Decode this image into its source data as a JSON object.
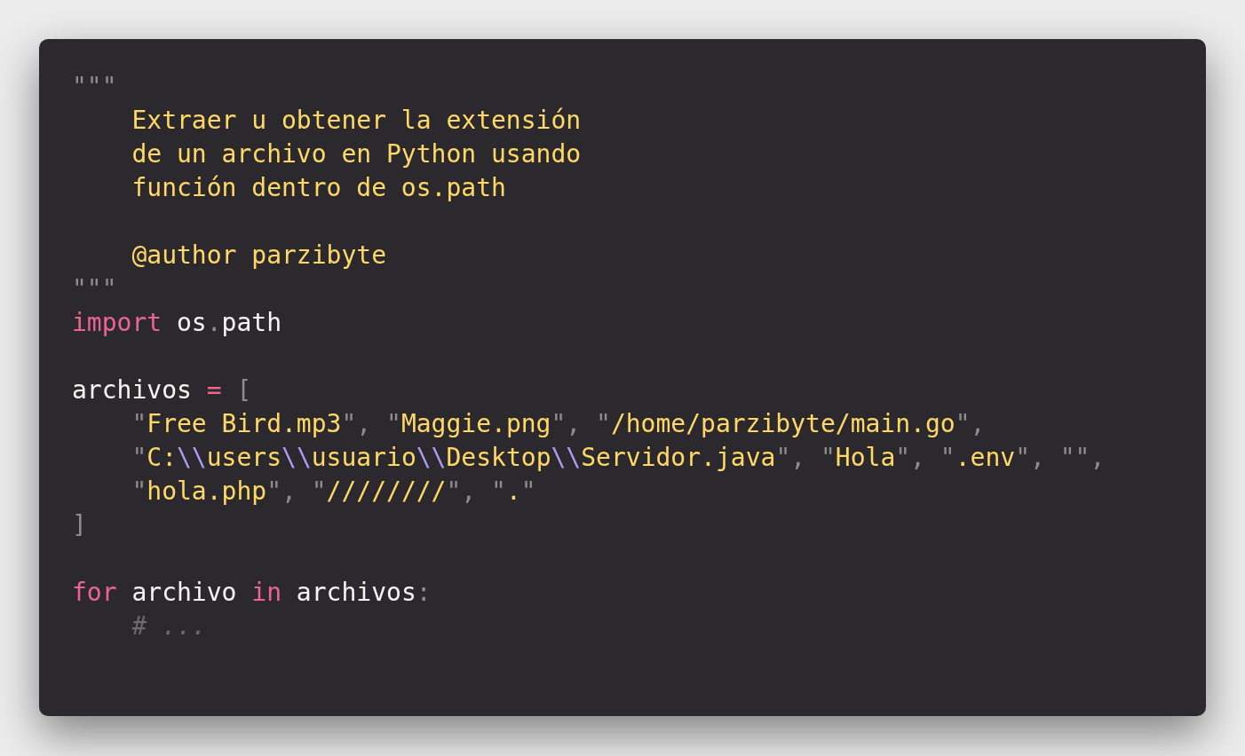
{
  "code_window": {
    "lines": [
      {
        "kind": "code",
        "tokens": [
          {
            "kind": "punct",
            "text": "\"\"\""
          }
        ]
      },
      {
        "kind": "code",
        "tokens": [
          {
            "kind": "docstring",
            "text": "    Extraer u obtener la extensión"
          }
        ]
      },
      {
        "kind": "code",
        "tokens": [
          {
            "kind": "docstring",
            "text": "    de un archivo en Python usando"
          }
        ]
      },
      {
        "kind": "code",
        "tokens": [
          {
            "kind": "docstring",
            "text": "    función dentro de os.path"
          }
        ]
      },
      {
        "kind": "blank"
      },
      {
        "kind": "code",
        "tokens": [
          {
            "kind": "docstring",
            "text": "    @author parzibyte"
          }
        ]
      },
      {
        "kind": "code",
        "tokens": [
          {
            "kind": "punct",
            "text": "\"\"\""
          }
        ]
      },
      {
        "kind": "code",
        "tokens": [
          {
            "kind": "keyword",
            "text": "import"
          },
          {
            "kind": "plain",
            "text": " os"
          },
          {
            "kind": "punct",
            "text": "."
          },
          {
            "kind": "plain",
            "text": "path"
          }
        ]
      },
      {
        "kind": "blank"
      },
      {
        "kind": "code",
        "tokens": [
          {
            "kind": "plain",
            "text": "archivos "
          },
          {
            "kind": "keyword",
            "text": "="
          },
          {
            "kind": "punct",
            "text": " ["
          }
        ]
      },
      {
        "kind": "code",
        "tokens": [
          {
            "kind": "punct",
            "text": "    \""
          },
          {
            "kind": "string",
            "text": "Free Bird.mp3"
          },
          {
            "kind": "punct",
            "text": "\", \""
          },
          {
            "kind": "string",
            "text": "Maggie.png"
          },
          {
            "kind": "punct",
            "text": "\", \""
          },
          {
            "kind": "string",
            "text": "/home/parzibyte/main.go"
          },
          {
            "kind": "punct",
            "text": "\","
          }
        ]
      },
      {
        "kind": "code",
        "tokens": [
          {
            "kind": "punct",
            "text": "    \""
          },
          {
            "kind": "string",
            "text": "C:"
          },
          {
            "kind": "escape",
            "text": "\\\\"
          },
          {
            "kind": "string",
            "text": "users"
          },
          {
            "kind": "escape",
            "text": "\\\\"
          },
          {
            "kind": "string",
            "text": "usuario"
          },
          {
            "kind": "escape",
            "text": "\\\\"
          },
          {
            "kind": "string",
            "text": "Desktop"
          },
          {
            "kind": "escape",
            "text": "\\\\"
          },
          {
            "kind": "string",
            "text": "Servidor.java"
          },
          {
            "kind": "punct",
            "text": "\", \""
          },
          {
            "kind": "string",
            "text": "Hola"
          },
          {
            "kind": "punct",
            "text": "\", \""
          },
          {
            "kind": "string",
            "text": ".env"
          },
          {
            "kind": "punct",
            "text": "\", \"\","
          }
        ]
      },
      {
        "kind": "code",
        "tokens": [
          {
            "kind": "punct",
            "text": "    \""
          },
          {
            "kind": "string",
            "text": "hola.php"
          },
          {
            "kind": "punct",
            "text": "\", \""
          },
          {
            "kind": "string",
            "text": "////////"
          },
          {
            "kind": "punct",
            "text": "\", \""
          },
          {
            "kind": "string",
            "text": "."
          },
          {
            "kind": "punct",
            "text": "\""
          }
        ]
      },
      {
        "kind": "code",
        "tokens": [
          {
            "kind": "punct",
            "text": "]"
          }
        ]
      },
      {
        "kind": "blank"
      },
      {
        "kind": "code",
        "tokens": [
          {
            "kind": "keyword",
            "text": "for"
          },
          {
            "kind": "plain",
            "text": " archivo "
          },
          {
            "kind": "keyword",
            "text": "in"
          },
          {
            "kind": "plain",
            "text": " archivos"
          },
          {
            "kind": "punct",
            "text": ":"
          }
        ]
      },
      {
        "kind": "code",
        "tokens": [
          {
            "kind": "comment",
            "text": "    # ..."
          }
        ]
      }
    ]
  }
}
